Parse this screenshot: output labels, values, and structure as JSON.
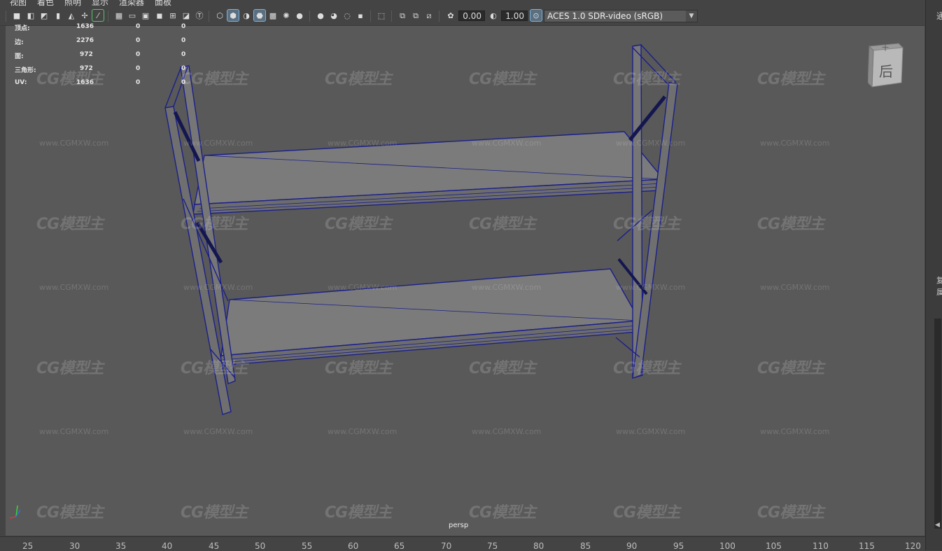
{
  "menubar": {
    "items": [
      "视图",
      "着色",
      "照明",
      "显示",
      "渲染器",
      "面板"
    ]
  },
  "toolbar": {
    "exposure_value": "0.00",
    "gamma_value": "1.00",
    "colorspace": "ACES 1.0 SDR-video (sRGB)",
    "icons": [
      "select-camera-icon",
      "camera-attributes-icon",
      "bookmark-icon",
      "image-plane-icon",
      "grid-toggle-icon",
      "film-gate-icon",
      "resolution-gate-icon",
      "gate-mask-icon",
      "field-chart-icon",
      "safe-action-icon",
      "safe-title-icon",
      "wireframe-icon",
      "smooth-shade-icon",
      "default-material-icon",
      "wireframe-on-shaded-icon",
      "textured-icon",
      "use-all-lights-icon",
      "shadows-icon",
      "screen-space-ao-icon",
      "motion-blur-icon",
      "multisample-aa-icon",
      "depth-of-field-icon",
      "isolate-select-icon",
      "xray-icon",
      "xray-joints-icon",
      "xray-active-components-icon",
      "exposure-icon",
      "gamma-icon",
      "color-management-icon"
    ]
  },
  "hud": {
    "rows": [
      {
        "label": "顶点:",
        "values": [
          "1636",
          "0",
          "0"
        ]
      },
      {
        "label": "边:",
        "values": [
          "2276",
          "0",
          "0"
        ]
      },
      {
        "label": "面:",
        "values": [
          "972",
          "0",
          "0"
        ]
      },
      {
        "label": "三角形:",
        "values": [
          "972",
          "0",
          "0"
        ]
      },
      {
        "label": "UV:",
        "values": [
          "1636",
          "0",
          "0"
        ]
      }
    ]
  },
  "viewcube": {
    "face_label": "后",
    "top_label": "十"
  },
  "camera_label": "persp",
  "watermark": {
    "logo": "CG模型主",
    "url": "www.CGMXW.com"
  },
  "right_panel": {
    "glyph_top": "通",
    "glyph_mid": [
      "复",
      "属"
    ]
  },
  "timeline": {
    "ticks": [
      "25",
      "30",
      "35",
      "40",
      "45",
      "50",
      "55",
      "60",
      "65",
      "70",
      "75",
      "80",
      "85",
      "90",
      "95",
      "100",
      "105",
      "110",
      "115",
      "120"
    ]
  },
  "colors": {
    "viewport_bg": "#595959",
    "wireframe": "#1b1f8a",
    "shelf_fill": "#7a7a7a",
    "ui_bg": "#444444"
  }
}
